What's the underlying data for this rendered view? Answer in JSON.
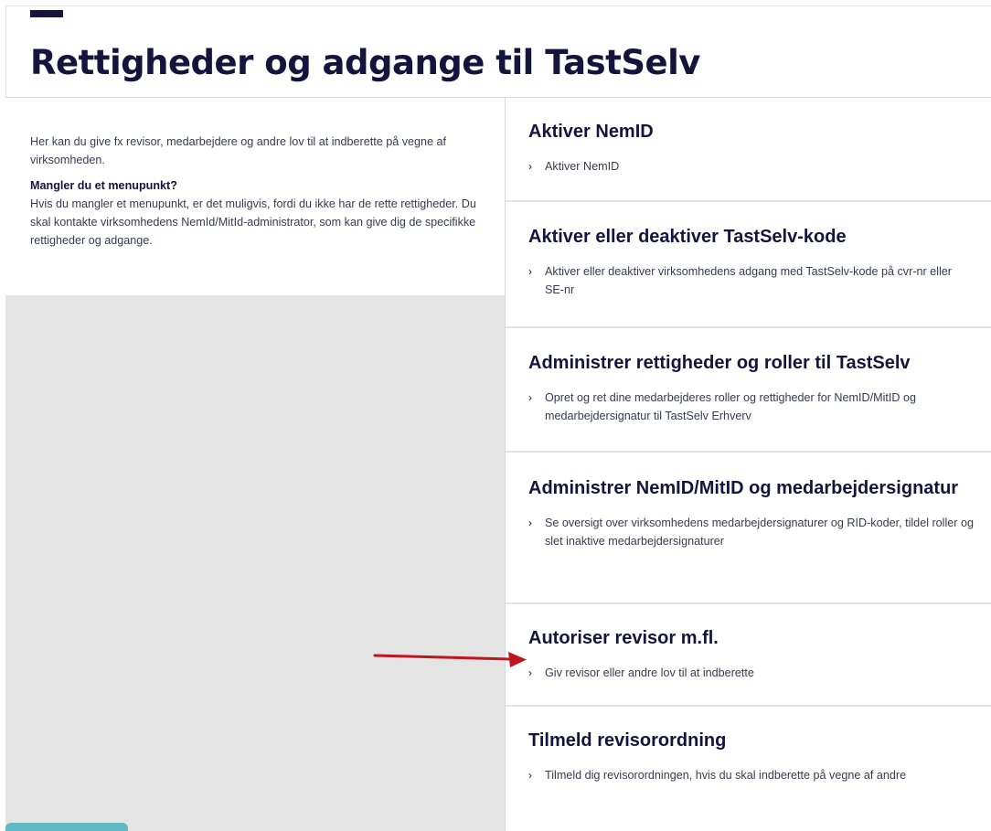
{
  "header": {
    "title": "Rettigheder og adgange til TastSelv"
  },
  "intro": {
    "text": "Her kan du give fx revisor, medarbejdere og andre lov til at indberette på vegne af virksomheden.",
    "heading": "Mangler du et menupunkt?",
    "body": "Hvis du mangler et menupunkt, er det muligvis, fordi du ikke har de rette rettigheder. Du skal kontakte virksomhedens NemId/MitId-administrator, som kan give dig de specifikke rettigheder og adgange."
  },
  "cards": [
    {
      "title": "Aktiver NemID",
      "link": "Aktiver NemID"
    },
    {
      "title": "Aktiver eller deaktiver TastSelv-kode",
      "link": "Aktiver eller deaktiver virksomhedens adgang med TastSelv-kode på cvr-nr eller SE-nr"
    },
    {
      "title": "Administrer rettigheder og roller til TastSelv",
      "link": "Opret og ret dine medarbejderes roller og rettigheder for NemID/MitID og medarbejdersignatur til TastSelv Erhverv"
    },
    {
      "title": "Administrer NemID/MitID og medarbejdersignatur",
      "link": "Se oversigt over virksomhedens medarbejdersignaturer og RID-koder, tildel roller og slet inaktive medarbejdersignaturer"
    },
    {
      "title": "Autoriser revisor m.fl.",
      "link": "Giv revisor eller andre lov til at indberette"
    },
    {
      "title": "Tilmeld revisorordning",
      "link": "Tilmeld dig revisorordningen, hvis du skal indberette på vegne af andre"
    }
  ],
  "icons": {
    "chevron": "chevron-right-icon",
    "annotation": "red-arrow-annotation"
  },
  "colors": {
    "brand_navy": "#14143c",
    "panel_grey": "#e4e4e4",
    "arrow_red": "#c0141e",
    "tab_teal": "#5fb8c4"
  }
}
